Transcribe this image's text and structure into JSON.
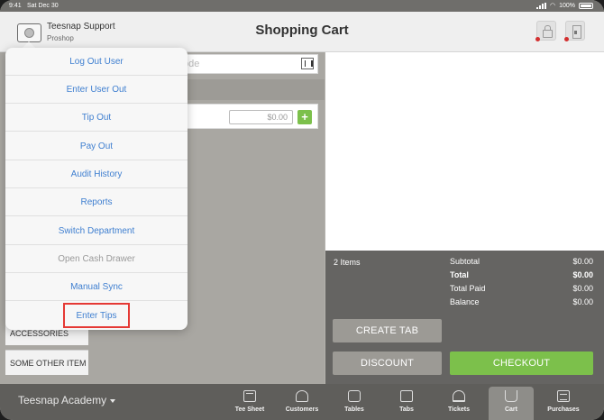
{
  "status_bar": {
    "time": "9:41",
    "date": "Sat Dec 30",
    "battery": "100%"
  },
  "header": {
    "user_name": "Teesnap Support",
    "user_dept": "Proshop",
    "title": "Shopping Cart",
    "icons": [
      "lock-icon",
      "cash-drawer-icon"
    ]
  },
  "search": {
    "placeholder": "ode"
  },
  "item": {
    "price_placeholder": "$0.00",
    "add_label": "+"
  },
  "categories": [
    "ACCESSORIES",
    "SOME OTHER ITEM"
  ],
  "menu": {
    "items": [
      {
        "label": "Log Out User",
        "enabled": true
      },
      {
        "label": "Enter User Out",
        "enabled": true
      },
      {
        "label": "Tip Out",
        "enabled": true
      },
      {
        "label": "Pay Out",
        "enabled": true
      },
      {
        "label": "Audit History",
        "enabled": true
      },
      {
        "label": "Reports",
        "enabled": true
      },
      {
        "label": "Switch Department",
        "enabled": true
      },
      {
        "label": "Open Cash Drawer",
        "enabled": false
      },
      {
        "label": "Manual Sync",
        "enabled": true
      },
      {
        "label": "Enter Tips",
        "enabled": true
      }
    ],
    "highlighted": "Enter Tips",
    "highlight_color": "#e53935"
  },
  "cart": {
    "items_count": "2 Items",
    "totals": [
      {
        "label": "Subtotal",
        "value": "$0.00"
      },
      {
        "label": "Total",
        "value": "$0.00"
      },
      {
        "label": "Total Paid",
        "value": "$0.00"
      },
      {
        "label": "Balance",
        "value": "$0.00"
      }
    ],
    "buttons": {
      "create_tab": "CREATE TAB",
      "discount": "DISCOUNT",
      "checkout": "CHECKOUT"
    },
    "checkout_color": "#7cc04b"
  },
  "nav": {
    "company": "Teesnap Academy",
    "items": [
      {
        "label": "Tee Sheet",
        "icon": "calendar-icon"
      },
      {
        "label": "Customers",
        "icon": "customers-icon"
      },
      {
        "label": "Tables",
        "icon": "tables-icon"
      },
      {
        "label": "Tabs",
        "icon": "tabs-icon"
      },
      {
        "label": "Tickets",
        "icon": "tickets-icon"
      },
      {
        "label": "Cart",
        "icon": "cart-icon"
      },
      {
        "label": "Purchases",
        "icon": "register-icon"
      }
    ],
    "active": "Cart"
  }
}
